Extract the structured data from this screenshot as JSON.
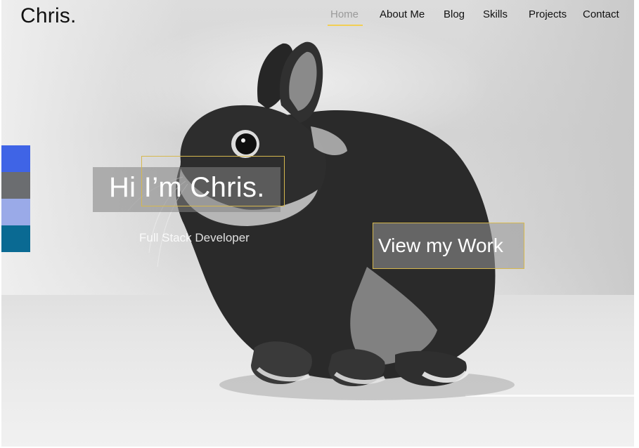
{
  "brand": {
    "name": "Chris."
  },
  "nav": {
    "items": [
      {
        "label": "Home",
        "active": true
      },
      {
        "label": "About Me",
        "active": false
      },
      {
        "label": "Blog",
        "active": false
      },
      {
        "label": "Skills",
        "active": false
      },
      {
        "label": "Projects",
        "active": false
      },
      {
        "label": "Contact",
        "active": false
      }
    ],
    "active_underline_color": "#f2cf55"
  },
  "theme_swatches": [
    "#3f64e6",
    "#6b6d70",
    "#9aaae8",
    "#0a6a93"
  ],
  "hero": {
    "title": "Hi I’m Chris.",
    "subtitle": "Full Stack Developer",
    "cta_label": "View my Work",
    "accent_outline_color": "#d6b84e"
  }
}
